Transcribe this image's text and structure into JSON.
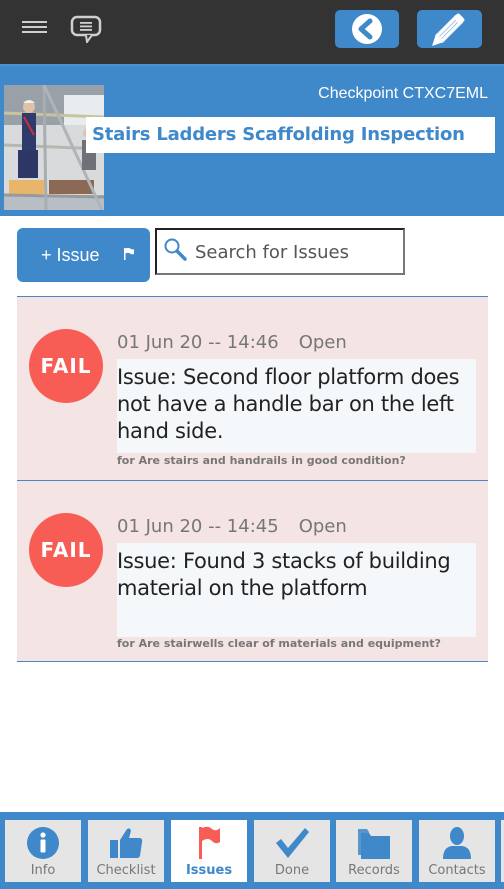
{
  "topbar": {
    "menu_icon": "hamburger-menu-icon",
    "chat_icon": "chat-bubble-icon",
    "back_icon": "back-chevron-icon",
    "edit_icon": "pencil-icon"
  },
  "header": {
    "checkpoint": "Checkpoint CTXC7EML",
    "title": "Stairs Ladders Scaffolding Inspection",
    "thumbnail": "scaffolding-workers-photo"
  },
  "toolbar": {
    "add_issue_label": "+ Issue",
    "add_issue_icon": "flag-icon",
    "search_placeholder": "Search for Issues",
    "search_value": ""
  },
  "issues": [
    {
      "badge": "FAIL",
      "date": "01 Jun 20 -- 14:46",
      "status": "Open",
      "description": "Issue: Second floor platform does not have a handle bar on the left hand side.",
      "question": "for Are stairs and handrails in good condition?"
    },
    {
      "badge": "FAIL",
      "date": "01 Jun 20 -- 14:45",
      "status": "Open",
      "description": "Issue: Found 3 stacks of building material on the platform",
      "question": "for Are stairwells clear of materials and equipment?"
    }
  ],
  "tabs": [
    {
      "label": "Info",
      "icon": "info-icon",
      "active": false
    },
    {
      "label": "Checklist",
      "icon": "thumbs-up-icon",
      "active": false
    },
    {
      "label": "Issues",
      "icon": "flag-icon",
      "active": true
    },
    {
      "label": "Done",
      "icon": "checkmark-icon",
      "active": false
    },
    {
      "label": "Records",
      "icon": "folder-icon",
      "active": false
    },
    {
      "label": "Contacts",
      "icon": "person-icon",
      "active": false
    }
  ],
  "colors": {
    "accent": "#3f88c9",
    "topbar": "#333333",
    "fail": "#f75c55",
    "issue_bg": "#f5e4e4",
    "active_flag": "#f75c55"
  }
}
